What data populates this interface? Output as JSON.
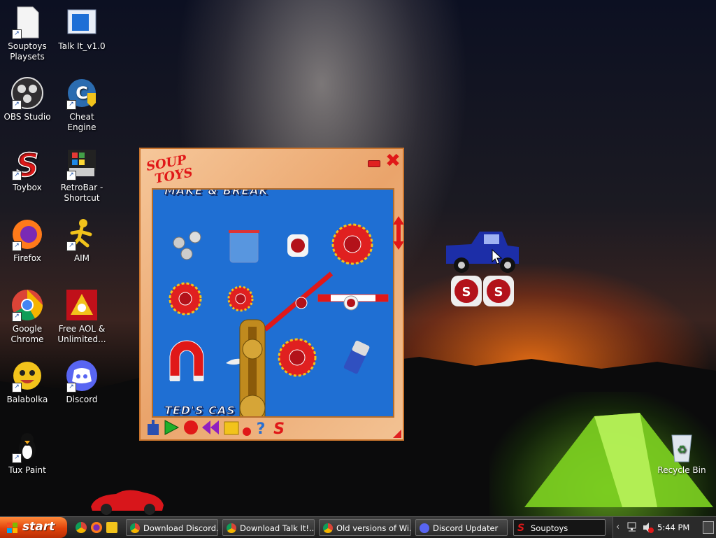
{
  "desktop_icons": [
    {
      "label": "Souptoys Playsets",
      "icon": "document-icon"
    },
    {
      "label": "Talk It_v1.0",
      "icon": "window-app-icon"
    },
    {
      "label": "OBS Studio",
      "icon": "obs-icon"
    },
    {
      "label": "Cheat Engine",
      "icon": "cheat-engine-icon"
    },
    {
      "label": "Toybox",
      "icon": "souptoys-s-icon"
    },
    {
      "label": "RetroBar - Shortcut",
      "icon": "retrobar-icon"
    },
    {
      "label": "Firefox",
      "icon": "firefox-icon"
    },
    {
      "label": "AIM",
      "icon": "aim-icon"
    },
    {
      "label": "Google Chrome",
      "icon": "chrome-icon"
    },
    {
      "label": "Free AOL & Unlimited...",
      "icon": "aol-icon"
    },
    {
      "label": "Balabolka",
      "icon": "balabolka-icon"
    },
    {
      "label": "Discord",
      "icon": "discord-icon"
    },
    {
      "label": "Tux Paint",
      "icon": "tux-icon"
    },
    {
      "label": "Recycle Bin",
      "icon": "recycle-bin-icon"
    }
  ],
  "souptoys": {
    "logo_line1": "SOUP",
    "logo_line2": "TOYS",
    "top_banner": "MAKE & BREAK",
    "bottom_banner": "TED'S CAS"
  },
  "taskbar": {
    "start_label": "start",
    "tasks": [
      {
        "label": "Download Discord...",
        "icon": "chrome-icon"
      },
      {
        "label": "Download Talk It!...",
        "icon": "chrome-icon"
      },
      {
        "label": "Old versions of Wi...",
        "icon": "chrome-icon"
      },
      {
        "label": "Discord Updater",
        "icon": "discord-icon"
      },
      {
        "label": "Souptoys",
        "icon": "souptoys-s-icon"
      }
    ],
    "clock": "5:44 PM"
  },
  "colors": {
    "taskbar_bg": "#1d1d1d",
    "start_orange": "#e0420a",
    "playfield_blue": "#1f6fd3",
    "window_frame": "#eaa46b"
  }
}
